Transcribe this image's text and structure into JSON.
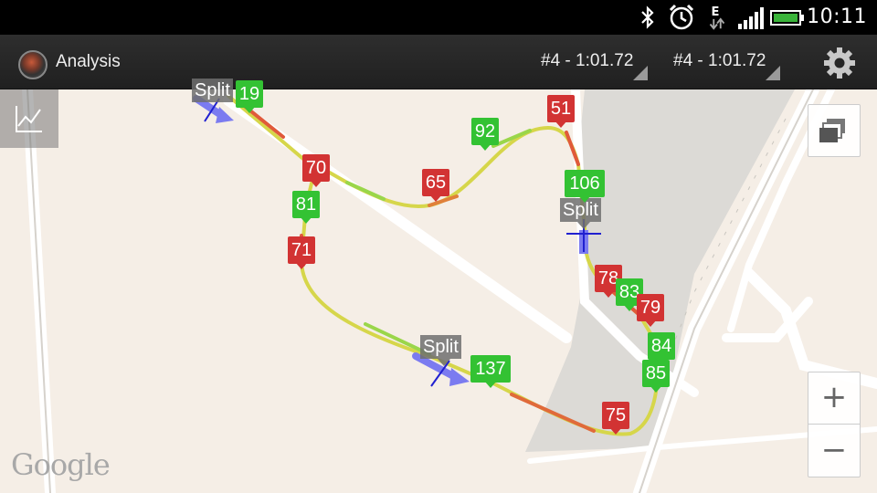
{
  "status_bar": {
    "time": "10:11",
    "icons": [
      "bluetooth-icon",
      "alarm-icon",
      "data-e-icon",
      "signal-icon",
      "battery-icon"
    ]
  },
  "action_bar": {
    "title": "Analysis",
    "lap_primary": "#4 - 1:01.72",
    "lap_secondary": "#4 - 1:01.72",
    "settings_icon": "gear-icon"
  },
  "map": {
    "attribution": "Google",
    "zoom_in": "+",
    "zoom_out": "−",
    "chart_icon": "line-chart-icon",
    "layers_icon": "layers-icon",
    "split_label": "Split",
    "markers": [
      {
        "id": "m19",
        "value": "19",
        "status": "green"
      },
      {
        "id": "m70",
        "value": "70",
        "status": "red"
      },
      {
        "id": "m81",
        "value": "81",
        "status": "green"
      },
      {
        "id": "m71",
        "value": "71",
        "status": "red"
      },
      {
        "id": "m65",
        "value": "65",
        "status": "red"
      },
      {
        "id": "m92",
        "value": "92",
        "status": "green"
      },
      {
        "id": "m51",
        "value": "51",
        "status": "red"
      },
      {
        "id": "m106",
        "value": "106",
        "status": "green"
      },
      {
        "id": "m78",
        "value": "78",
        "status": "red"
      },
      {
        "id": "m83",
        "value": "83",
        "status": "green"
      },
      {
        "id": "m79",
        "value": "79",
        "status": "red"
      },
      {
        "id": "m84",
        "value": "84",
        "status": "green"
      },
      {
        "id": "m85",
        "value": "85",
        "status": "green"
      },
      {
        "id": "m137",
        "value": "137",
        "status": "green"
      },
      {
        "id": "m75",
        "value": "75",
        "status": "red"
      }
    ]
  }
}
